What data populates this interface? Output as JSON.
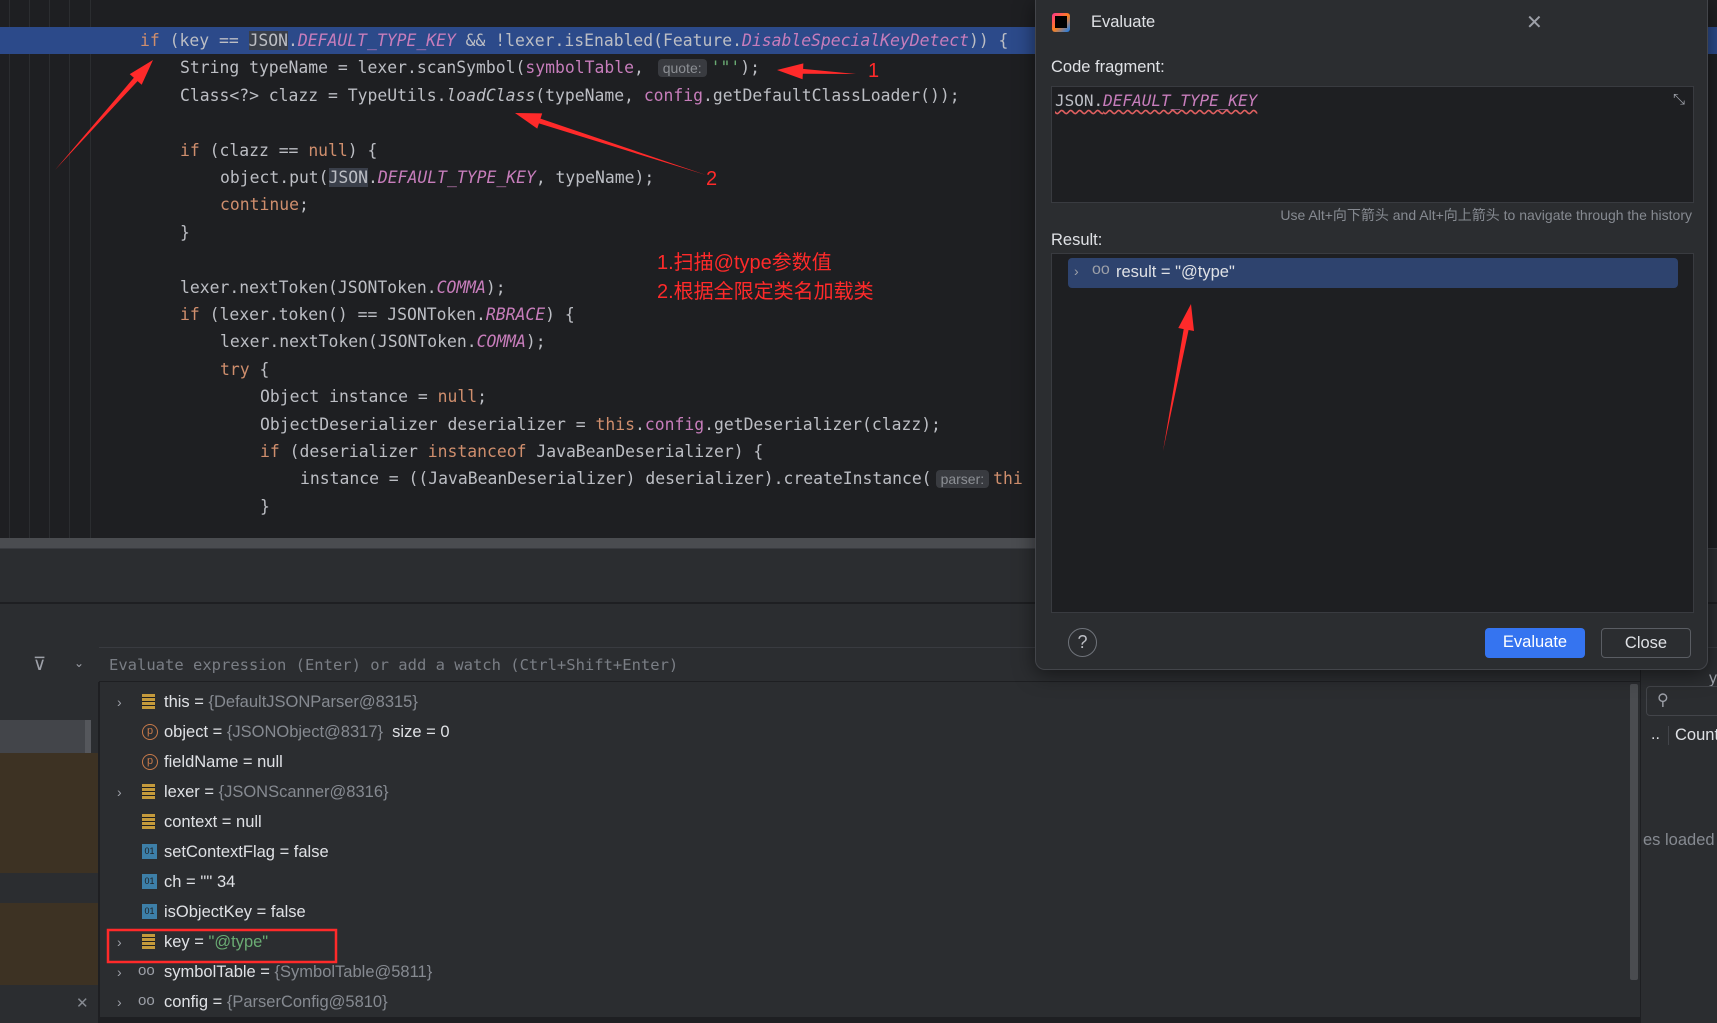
{
  "editor": {
    "lines": [
      {
        "indent": 0,
        "tokens": [
          [
            "if",
            "kw"
          ],
          [
            " (key == ",
            ""
          ],
          [
            "JSON",
            "sel"
          ],
          [
            ".",
            ""
          ],
          [
            "DEFAULT_TYPE_KEY",
            "fld"
          ],
          [
            " && !lexer.isEnabled(Feature.",
            ""
          ],
          [
            "DisableSpecialKeyDetect",
            "fld"
          ],
          [
            ")) {",
            ""
          ]
        ]
      },
      {
        "indent": 1,
        "tokens": [
          [
            "String typeName = lexer.scanSymbol(",
            ""
          ],
          [
            "symbolTable",
            "fldn"
          ],
          [
            ", ",
            ""
          ],
          [
            "quote:",
            "hint"
          ],
          [
            "'\"'",
            "str"
          ],
          [
            ");",
            ""
          ]
        ]
      },
      {
        "indent": 1,
        "tokens": [
          [
            "Class<?> clazz = TypeUtils.",
            ""
          ],
          [
            "loadClass",
            "it"
          ],
          [
            "(typeName, ",
            ""
          ],
          [
            "config",
            "fldn"
          ],
          [
            ".getDefaultClassLoader());",
            ""
          ]
        ]
      },
      {
        "indent": 0,
        "tokens": []
      },
      {
        "indent": 1,
        "tokens": [
          [
            "if",
            "kw"
          ],
          [
            " (clazz == ",
            ""
          ],
          [
            "null",
            "kw"
          ],
          [
            ") {",
            ""
          ]
        ]
      },
      {
        "indent": 2,
        "tokens": [
          [
            "object.put(",
            ""
          ],
          [
            "JSON",
            "sel"
          ],
          [
            ".",
            ""
          ],
          [
            "DEFAULT_TYPE_KEY",
            "fld"
          ],
          [
            ", typeName);",
            ""
          ]
        ]
      },
      {
        "indent": 2,
        "tokens": [
          [
            "continue",
            "kw"
          ],
          [
            ";",
            ""
          ]
        ]
      },
      {
        "indent": 1,
        "tokens": [
          [
            "}",
            ""
          ]
        ]
      },
      {
        "indent": 0,
        "tokens": []
      },
      {
        "indent": 1,
        "tokens": [
          [
            "lexer.nextToken(JSONToken.",
            ""
          ],
          [
            "COMMA",
            "fld"
          ],
          [
            ");",
            ""
          ]
        ]
      },
      {
        "indent": 1,
        "tokens": [
          [
            "if",
            "kw"
          ],
          [
            " (lexer.token() == JSONToken.",
            ""
          ],
          [
            "RBRACE",
            "fld"
          ],
          [
            ") {",
            ""
          ]
        ]
      },
      {
        "indent": 2,
        "tokens": [
          [
            "lexer.nextToken(JSONToken.",
            ""
          ],
          [
            "COMMA",
            "fld"
          ],
          [
            ");",
            ""
          ]
        ]
      },
      {
        "indent": 2,
        "tokens": [
          [
            "try",
            "kw"
          ],
          [
            " {",
            ""
          ]
        ]
      },
      {
        "indent": 3,
        "tokens": [
          [
            "Object instance = ",
            ""
          ],
          [
            "null",
            "kw"
          ],
          [
            ";",
            ""
          ]
        ]
      },
      {
        "indent": 3,
        "tokens": [
          [
            "ObjectDeserializer deserializer = ",
            ""
          ],
          [
            "this",
            "kw"
          ],
          [
            ".",
            ""
          ],
          [
            "config",
            "fldn"
          ],
          [
            ".getDeserializer(clazz);",
            ""
          ]
        ]
      },
      {
        "indent": 3,
        "tokens": [
          [
            "if",
            "kw"
          ],
          [
            " (deserializer ",
            ""
          ],
          [
            "instanceof",
            "kw"
          ],
          [
            " JavaBeanDeserializer) {",
            ""
          ]
        ]
      },
      {
        "indent": 4,
        "tokens": [
          [
            "instance = ((JavaBeanDeserializer) deserializer).createInstance(",
            ""
          ],
          [
            "parser:",
            "hint"
          ],
          [
            "thi",
            "kw"
          ]
        ]
      },
      {
        "indent": 3,
        "tokens": [
          [
            "}",
            ""
          ]
        ]
      }
    ]
  },
  "annotations": {
    "arrow1_label": "1",
    "arrow2_label": "2",
    "note1": "1.扫描@type参数值",
    "note2": "2.根据全限定类名加载类",
    "color": "#ff2a2a"
  },
  "debugger": {
    "eval_placeholder": "Evaluate expression (Enter) or add a watch (Ctrl+Shift+Enter)",
    "variables": [
      {
        "expand": true,
        "icon": "field",
        "name": "this",
        "eq": " = ",
        "value": "{DefaultJSONParser@8315}",
        "style": "gray",
        "extra": ""
      },
      {
        "expand": false,
        "icon": "param",
        "name": "object",
        "eq": " = ",
        "value": "{JSONObject@8317}",
        "style": "gray",
        "extra": "  size = 0"
      },
      {
        "expand": false,
        "icon": "param",
        "name": "fieldName",
        "eq": " = ",
        "value": "null",
        "style": "",
        "extra": ""
      },
      {
        "expand": true,
        "icon": "field",
        "name": "lexer",
        "eq": " = ",
        "value": "{JSONScanner@8316}",
        "style": "gray",
        "extra": ""
      },
      {
        "expand": false,
        "icon": "field",
        "name": "context",
        "eq": " = ",
        "value": "null",
        "style": "",
        "extra": ""
      },
      {
        "expand": false,
        "icon": "primitive",
        "name": "setContextFlag",
        "eq": " = ",
        "value": "false",
        "style": "",
        "extra": ""
      },
      {
        "expand": false,
        "icon": "primitive",
        "name": "ch",
        "eq": " = ",
        "value": "'\"' 34",
        "style": "",
        "extra": ""
      },
      {
        "expand": false,
        "icon": "primitive",
        "name": "isObjectKey",
        "eq": " = ",
        "value": "false",
        "style": "",
        "extra": ""
      },
      {
        "expand": true,
        "icon": "field",
        "name": "key",
        "eq": " = ",
        "value": "\"@type\"",
        "style": "green",
        "extra": "",
        "boxed": true
      },
      {
        "expand": true,
        "icon": "watch",
        "name": "symbolTable",
        "eq": " = ",
        "value": "{SymbolTable@5811}",
        "style": "gray",
        "extra": ""
      },
      {
        "expand": true,
        "icon": "watch",
        "name": "config",
        "eq": " = ",
        "value": "{ParserConfig@5810}",
        "style": "gray",
        "extra": ""
      }
    ],
    "right_panel": {
      "column": "Count",
      "dots": "..",
      "status": "es loaded",
      "cut_letter": "y"
    }
  },
  "dialog": {
    "title": "Evaluate",
    "code_label": "Code fragment:",
    "code_prefix": "JSON.",
    "code_field": "DEFAULT_TYPE_KEY",
    "history_hint": "Use Alt+向下箭头 and Alt+向上箭头 to navigate through the history",
    "result_label": "Result:",
    "result_text": "result = \"@type\"",
    "help": "?",
    "evaluate_button": "Evaluate",
    "close_button": "Close",
    "accent": "#3574f0"
  }
}
